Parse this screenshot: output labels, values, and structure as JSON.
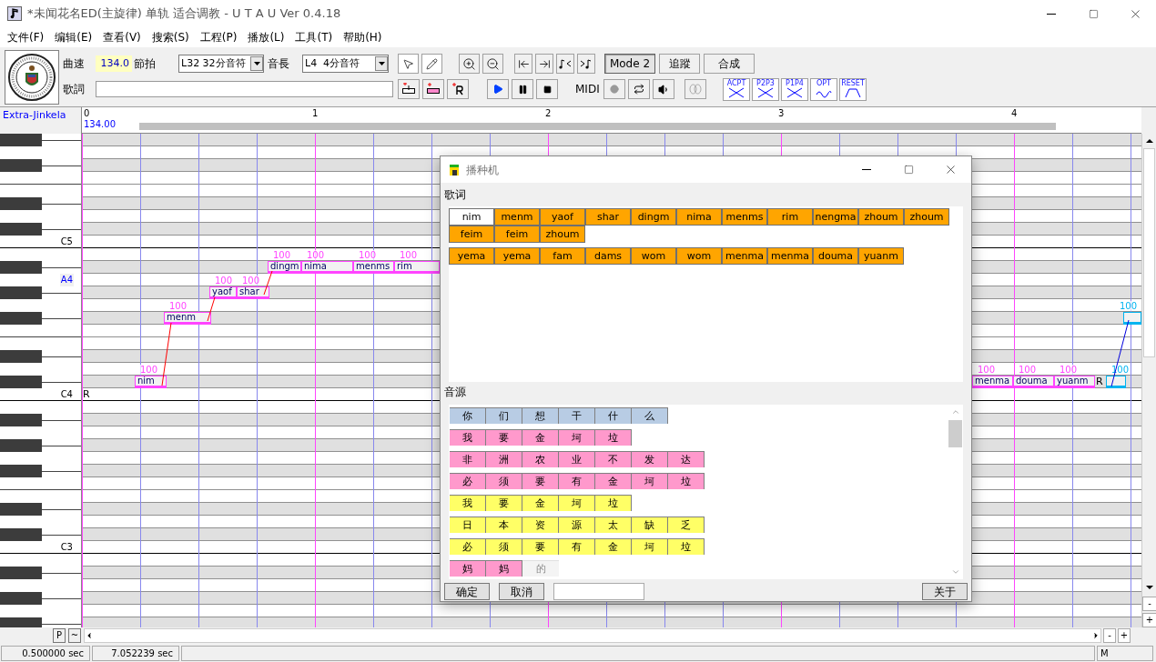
{
  "window": {
    "title": "*未闻花名ED(主旋律) 单轨 适合调教 - U T A U Ver 0.4.18"
  },
  "menu": [
    "文件(F)",
    "编辑(E)",
    "查看(V)",
    "搜索(S)",
    "工程(P)",
    "播放(L)",
    "工具(T)",
    "帮助(H)"
  ],
  "toolbar": {
    "tempo_label": "曲速",
    "tempo": "134.0",
    "beat_label": "節拍",
    "quantize": "L32 32分音符",
    "length_label": "音長",
    "length": "L4  4分音符",
    "mode_buttons": [
      {
        "label": "Mode 2",
        "pressed": true
      },
      {
        "label": "追蹤",
        "pressed": false
      },
      {
        "label": "合成",
        "pressed": false
      }
    ],
    "lyric_label": "歌詞",
    "midi_label": "MIDI",
    "envelope_buttons": [
      "ACPT",
      "P2P3",
      "P1P4",
      "OPT",
      "RESET"
    ]
  },
  "track": {
    "name": "Extra-Jinkela",
    "measures": [
      "0",
      "1",
      "2",
      "3",
      "4"
    ],
    "tempo": "134.00"
  },
  "piano": {
    "labels": [
      {
        "text": "C5",
        "highlighted": false
      },
      {
        "text": "A4",
        "highlighted": true
      },
      {
        "text": "C4",
        "highlighted": false
      },
      {
        "text": "C3",
        "highlighted": false
      }
    ]
  },
  "notes": [
    {
      "lyric": "nim",
      "velocity": "100",
      "color": "#ff44ff"
    },
    {
      "lyric": "menm",
      "velocity": "100",
      "color": "#ff44ff"
    },
    {
      "lyric": "yaof",
      "velocity": "100",
      "color": "#ff44ff"
    },
    {
      "lyric": "shar",
      "velocity": "100",
      "color": "#ff44ff"
    },
    {
      "lyric": "dingm",
      "velocity": "100",
      "color": "#ff44ff"
    },
    {
      "lyric": "nima",
      "velocity": "100",
      "color": "#ff44ff"
    },
    {
      "lyric": "menms",
      "velocity": "100",
      "color": "#ff44ff"
    },
    {
      "lyric": "rim",
      "velocity": "100",
      "color": "#ff44ff"
    },
    {
      "lyric": "menma",
      "velocity": "100",
      "color": "#ff44ff"
    },
    {
      "lyric": "douma",
      "velocity": "100",
      "color": "#ff44ff"
    },
    {
      "lyric": "yuanm",
      "velocity": "100",
      "color": "#ff44ff"
    },
    {
      "velocity": "100",
      "color": "#00b4f0"
    },
    {
      "velocity": "100",
      "color": "#00b4f0"
    }
  ],
  "rest_labels": [
    "R",
    "R"
  ],
  "dialog": {
    "title": "播种机",
    "lyrics_label": "歌词",
    "lyric_phrases": [
      [
        {
          "text": "nim",
          "selected": true
        },
        {
          "text": "menm",
          "selected": false
        },
        {
          "text": "yaof",
          "selected": false
        },
        {
          "text": "shar",
          "selected": false
        },
        {
          "text": "dingm",
          "selected": false
        },
        {
          "text": "nima",
          "selected": false
        },
        {
          "text": "menms",
          "selected": false
        },
        {
          "text": "rim",
          "selected": false
        },
        {
          "text": "nengma",
          "selected": false
        },
        {
          "text": "zhoum",
          "selected": false
        },
        {
          "text": "zhoum",
          "selected": false
        },
        {
          "text": "feim",
          "selected": false
        },
        {
          "text": "feim",
          "selected": false
        },
        {
          "text": "zhoum",
          "selected": false
        }
      ],
      [
        {
          "text": "yema",
          "selected": false
        },
        {
          "text": "yema",
          "selected": false
        },
        {
          "text": "fam",
          "selected": false
        },
        {
          "text": "dams",
          "selected": false
        },
        {
          "text": "wom",
          "selected": false
        },
        {
          "text": "wom",
          "selected": false
        },
        {
          "text": "menma",
          "selected": false
        },
        {
          "text": "menma",
          "selected": false
        },
        {
          "text": "douma",
          "selected": false
        },
        {
          "text": "yuanm",
          "selected": false
        }
      ]
    ],
    "source_label": "音源",
    "source_rows": [
      {
        "color": "#b8cce4",
        "chars": [
          "你",
          "们",
          "想",
          "干",
          "什",
          "么"
        ]
      },
      {
        "color": "#ff99cc",
        "chars": [
          "我",
          "要",
          "金",
          "坷",
          "垃"
        ]
      },
      {
        "color": "#ff99cc",
        "chars": [
          "非",
          "洲",
          "农",
          "业",
          "不",
          "发",
          "达"
        ]
      },
      {
        "color": "#ff99cc",
        "chars": [
          "必",
          "须",
          "要",
          "有",
          "金",
          "坷",
          "垃"
        ]
      },
      {
        "color": "#ffff66",
        "chars": [
          "我",
          "要",
          "金",
          "坷",
          "垃"
        ]
      },
      {
        "color": "#ffff66",
        "chars": [
          "日",
          "本",
          "资",
          "源",
          "太",
          "缺",
          "乏"
        ]
      },
      {
        "color": "#ffff66",
        "chars": [
          "必",
          "须",
          "要",
          "有",
          "金",
          "坷",
          "垃"
        ]
      },
      {
        "color": "#ff99cc",
        "chars": [
          "妈",
          "妈"
        ],
        "unfilled": [
          "的"
        ]
      }
    ],
    "buttons": [
      "确定",
      "取消"
    ],
    "about": "关于"
  },
  "bottom_buttons": [
    "P",
    "~"
  ],
  "zoom_buttons": [
    "-",
    "+"
  ],
  "status_bar": [
    "0.500000 sec",
    "7.052239 sec",
    "M"
  ]
}
